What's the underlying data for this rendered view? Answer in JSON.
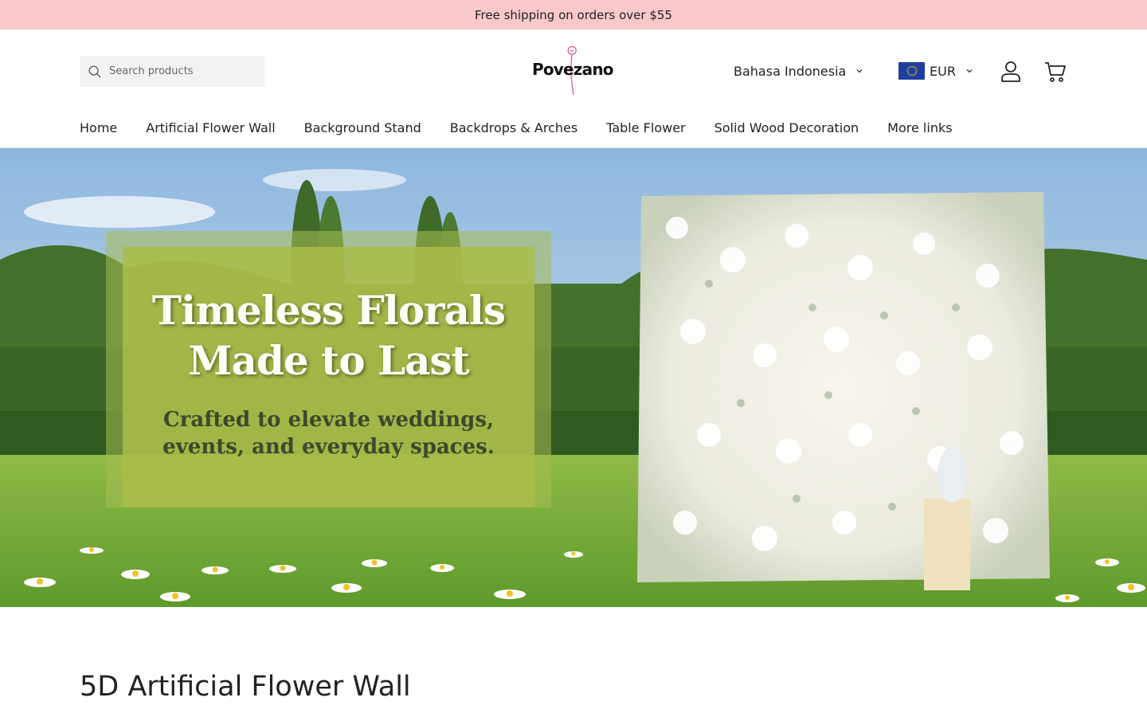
{
  "announcement": "Free shipping on orders over $55",
  "header": {
    "search_placeholder": "Search products",
    "logo_text": "Povezano",
    "language": "Bahasa Indonesia",
    "currency": "EUR"
  },
  "nav": {
    "items": [
      {
        "label": "Home"
      },
      {
        "label": "Artificial Flower Wall"
      },
      {
        "label": "Background Stand"
      },
      {
        "label": "Backdrops & Arches"
      },
      {
        "label": "Table Flower"
      },
      {
        "label": "Solid Wood Decoration"
      },
      {
        "label": "More links"
      }
    ]
  },
  "hero": {
    "title": "Timeless Florals\nMade to Last",
    "subtitle": "Crafted to elevate weddings,\nevents, and everyday spaces."
  },
  "section": {
    "title": "5D Artificial Flower Wall"
  },
  "colors": {
    "announcement_bg": "#f9c8cb",
    "hero_panel": "#aabc4a",
    "flag_blue": "#1f3f9f"
  },
  "icons": [
    "search-icon",
    "chevron-down-icon",
    "eu-flag-icon",
    "user-icon",
    "cart-icon",
    "rose-logo-icon"
  ]
}
